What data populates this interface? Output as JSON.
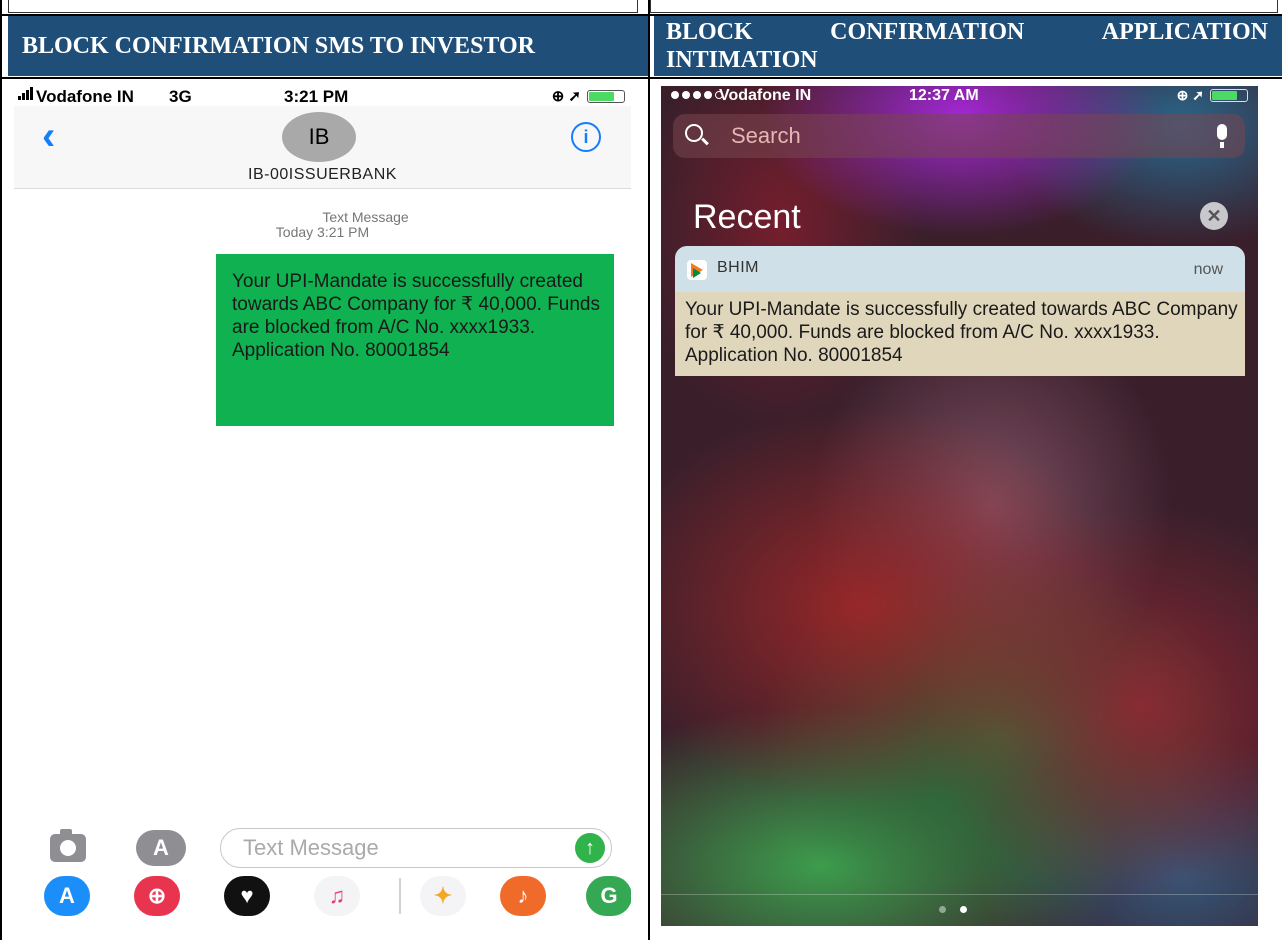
{
  "headers": {
    "left": "BLOCK CONFIRMATION SMS TO INVESTOR",
    "right_line1_words": [
      "BLOCK",
      "CONFIRMATION",
      "APPLICATION"
    ],
    "right_line2": "INTIMATION"
  },
  "left_phone": {
    "status": {
      "carrier": "Vodafone IN",
      "network": "3G",
      "time": "3:21 PM",
      "icons": "⊕ ➚"
    },
    "contact": {
      "avatar_initials": "IB",
      "name": "IB-00ISSUERBANK",
      "back": "‹",
      "info": "i"
    },
    "meta": {
      "type": "Text Message",
      "time": "Today 3:21 PM"
    },
    "message": "Your UPI-Mandate is successfully created towards ABC Company for ₹ 40,000. Funds are blocked from A/C No. xxxx1933. Application No. 80001854",
    "compose": {
      "placeholder": "Text Message",
      "send": "↑",
      "appstore": "A"
    },
    "apps": [
      {
        "name": "app-store-icon",
        "glyph": "A",
        "color": "#1c8ef9"
      },
      {
        "name": "search-images-icon",
        "glyph": "⊕",
        "color": "#e8344e"
      },
      {
        "name": "digital-touch-icon",
        "glyph": "♥",
        "color": "#111111"
      },
      {
        "name": "music-icon",
        "glyph": "♫",
        "color": "#f4f4f6"
      },
      {
        "name": "photos-icon",
        "glyph": "✦",
        "color": "#f4f4f6"
      },
      {
        "name": "garageband-icon",
        "glyph": "♪",
        "color": "#f06a2a"
      },
      {
        "name": "maps-icon",
        "glyph": "G",
        "color": "#34a853"
      }
    ]
  },
  "right_phone": {
    "status": {
      "carrier": "Vodafone IN",
      "time": "12:37 AM",
      "icons": "⊕ ➚"
    },
    "search_placeholder": "Search",
    "recent_title": "Recent",
    "clear": "✕",
    "notification": {
      "app": "BHIM",
      "time": "now",
      "body": "Your UPI-Mandate is successfully created towards ABC Company for ₹ 40,000. Funds are blocked from A/C No. xxxx1933. Application No. 80001854"
    }
  }
}
